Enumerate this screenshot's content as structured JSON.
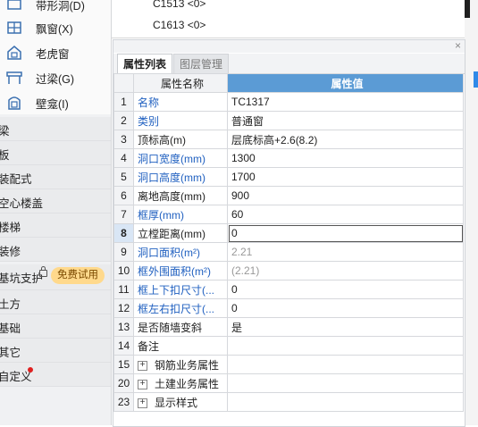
{
  "sidebar": {
    "items": [
      {
        "label": "带形洞(D)",
        "icon": "strip-hole-icon"
      },
      {
        "label": "飘窗(X)",
        "icon": "bay-window-icon"
      },
      {
        "label": "老虎窗",
        "icon": "dormer-window-icon"
      },
      {
        "label": "过梁(G)",
        "icon": "lintel-icon"
      },
      {
        "label": "壁龛(I)",
        "icon": "niche-icon"
      }
    ],
    "groups": [
      {
        "label": "梁"
      },
      {
        "label": "板"
      },
      {
        "label": "装配式"
      },
      {
        "label": "空心楼盖"
      },
      {
        "label": "楼梯"
      },
      {
        "label": "装修"
      },
      {
        "label": "基坑支护",
        "badge": "免费试用"
      },
      {
        "label": "土方"
      },
      {
        "label": "基础"
      },
      {
        "label": "其它"
      },
      {
        "label": "自定义"
      }
    ]
  },
  "component_list": [
    "C1513 <0>",
    "C1613 <0>"
  ],
  "panel": {
    "tabs": [
      {
        "label": "属性列表",
        "active": true
      },
      {
        "label": "图层管理",
        "active": false
      }
    ],
    "header": {
      "name": "属性名称",
      "value": "属性值"
    },
    "rows": [
      {
        "num": "1",
        "name": "名称",
        "value": "TC1317",
        "name_blue": true
      },
      {
        "num": "2",
        "name": "类别",
        "value": "普通窗",
        "name_blue": true
      },
      {
        "num": "3",
        "name": "顶标高(m)",
        "value": "层底标高+2.6(8.2)"
      },
      {
        "num": "4",
        "name": "洞口宽度(mm)",
        "value": "1300",
        "name_blue": true
      },
      {
        "num": "5",
        "name": "洞口高度(mm)",
        "value": "1700",
        "name_blue": true
      },
      {
        "num": "6",
        "name": "离地高度(mm)",
        "value": "900"
      },
      {
        "num": "7",
        "name": "框厚(mm)",
        "value": "60",
        "name_blue": true
      },
      {
        "num": "8",
        "name": "立樘距离(mm)",
        "value": "0",
        "selected": true
      },
      {
        "num": "9",
        "name": "洞口面积(m²)",
        "value": "2.21",
        "name_blue": true,
        "value_gray": true
      },
      {
        "num": "10",
        "name": "框外围面积(m²)",
        "value": "(2.21)",
        "name_blue": true,
        "value_gray": true
      },
      {
        "num": "11",
        "name": "框上下扣尺寸(...",
        "value": "0",
        "name_blue": true
      },
      {
        "num": "12",
        "name": "框左右扣尺寸(...",
        "value": "0",
        "name_blue": true
      },
      {
        "num": "13",
        "name": "是否随墙变斜",
        "value": "是"
      },
      {
        "num": "14",
        "name": "备注",
        "value": ""
      },
      {
        "num": "15",
        "name": "钢筋业务属性",
        "value": "",
        "expandable": true
      },
      {
        "num": "20",
        "name": "土建业务属性",
        "value": "",
        "expandable": true
      },
      {
        "num": "23",
        "name": "显示样式",
        "value": "",
        "expandable": true
      }
    ]
  }
}
